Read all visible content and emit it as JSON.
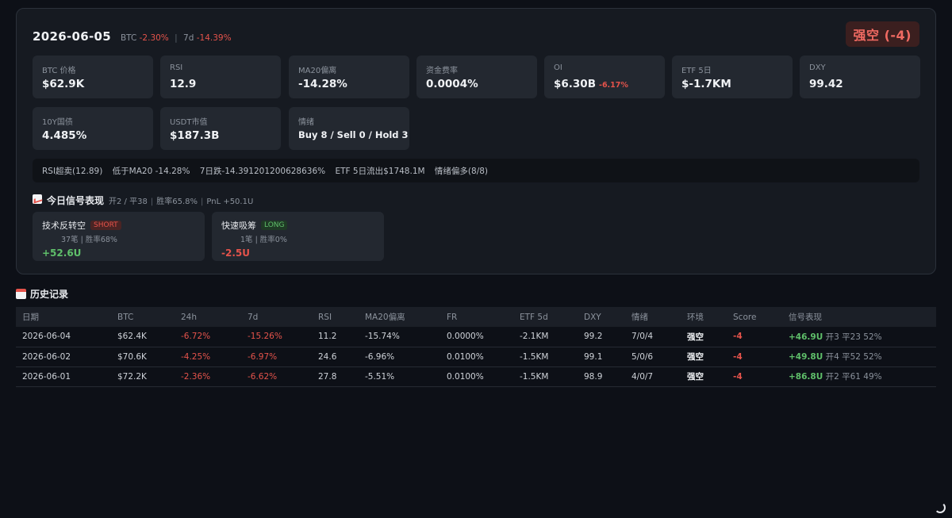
{
  "header": {
    "date": "2026-06-05",
    "btc_label": "BTC",
    "btc_change": "-2.30%",
    "sep": "|",
    "week_label": "7d",
    "week_change": "-14.39%",
    "regime": "强空 (-4)"
  },
  "metrics": [
    {
      "label": "BTC 价格",
      "value": "$62.9K",
      "change": ""
    },
    {
      "label": "RSI",
      "value": "12.9",
      "change": ""
    },
    {
      "label": "MA20偏离",
      "value": "-14.28%",
      "change": ""
    },
    {
      "label": "资金费率",
      "value": "0.0004%",
      "change": ""
    },
    {
      "label": "OI",
      "value": "$6.30B",
      "change": "-6.17%"
    },
    {
      "label": "ETF 5日",
      "value": "$-1.7KM",
      "change": ""
    },
    {
      "label": "DXY",
      "value": "99.42",
      "change": ""
    },
    {
      "label": "10Y国债",
      "value": "4.485%",
      "change": ""
    },
    {
      "label": "USDT市值",
      "value": "$187.3B",
      "change": ""
    },
    {
      "label": "情绪",
      "value": "Buy 8 / Sell 0 / Hold 3",
      "change": ""
    }
  ],
  "summary": [
    "RSI超卖(12.89)",
    "低于MA20 -14.28%",
    "7日跌-14.391201200628636%",
    "ETF 5日流出$1748.1M",
    "情绪偏多(8/8)"
  ],
  "signals": {
    "title": "今日信号表现",
    "stats": [
      "开2 / 平38",
      "胜率65.8%",
      "PnL +50.1U"
    ],
    "items": [
      {
        "name": "技术反转空",
        "tag": "SHORT",
        "detail": "37笔 | 胜率68%",
        "pnl": "+52.6U"
      },
      {
        "name": "快速吸筹",
        "tag": "LONG",
        "detail": "1笔 | 胜率0%",
        "pnl": "-2.5U"
      }
    ]
  },
  "history": {
    "title": "历史记录",
    "columns": [
      "日期",
      "BTC",
      "24h",
      "7d",
      "RSI",
      "MA20偏离",
      "FR",
      "ETF 5d",
      "DXY",
      "情绪",
      "环境",
      "Score",
      "信号表现"
    ],
    "rows": [
      {
        "date": "2026-06-04",
        "btc": "$62.4K",
        "d24": "-6.72%",
        "d7": "-15.26%",
        "rsi": "11.2",
        "ma20": "-15.74%",
        "fr": "0.0000%",
        "etf": "-2.1KM",
        "dxy": "99.2",
        "sent": "7/0/4",
        "env": "强空",
        "score": "-4",
        "pnl": "+46.9U",
        "sig": "开3 平23 52%"
      },
      {
        "date": "2026-06-02",
        "btc": "$70.6K",
        "d24": "-4.25%",
        "d7": "-6.97%",
        "rsi": "24.6",
        "ma20": "-6.96%",
        "fr": "0.0100%",
        "etf": "-1.5KM",
        "dxy": "99.1",
        "sent": "5/0/6",
        "env": "强空",
        "score": "-4",
        "pnl": "+49.8U",
        "sig": "开4 平52 52%"
      },
      {
        "date": "2026-06-01",
        "btc": "$72.2K",
        "d24": "-2.36%",
        "d7": "-6.62%",
        "rsi": "27.8",
        "ma20": "-5.51%",
        "fr": "0.0100%",
        "etf": "-1.5KM",
        "dxy": "98.9",
        "sent": "4/0/7",
        "env": "强空",
        "score": "-4",
        "pnl": "+86.8U",
        "sig": "开2 平61 49%"
      }
    ]
  },
  "colors": {
    "negative": "#e5534b",
    "positive": "#5fbf6a",
    "accent_bg": "#3b1f1f"
  },
  "icons": {
    "signal": "chart-icon",
    "history": "calendar-icon",
    "corner": "loading-icon"
  }
}
